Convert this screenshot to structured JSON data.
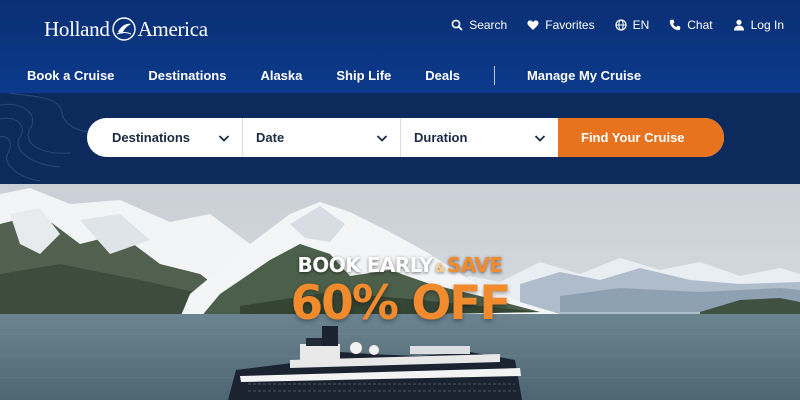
{
  "brand": {
    "name_left": "Holland",
    "name_right": "America"
  },
  "utility_nav": [
    {
      "label": "Search",
      "icon": "search-icon"
    },
    {
      "label": "Favorites",
      "icon": "heart-icon"
    },
    {
      "label": "EN",
      "icon": "globe-icon"
    },
    {
      "label": "Chat",
      "icon": "phone-icon"
    },
    {
      "label": "Log In",
      "icon": "user-icon"
    }
  ],
  "main_nav": {
    "items": [
      "Book a Cruise",
      "Destinations",
      "Alaska",
      "Ship Life",
      "Deals"
    ],
    "manage": "Manage My Cruise"
  },
  "search_bar": {
    "destinations": "Destinations",
    "date": "Date",
    "duration": "Duration",
    "submit": "Find Your Cruise"
  },
  "promo": {
    "line1_a": "BOOK EARLY",
    "amp": "&",
    "line1_b": "SAVE",
    "line2": "60% OFF"
  },
  "colors": {
    "header_blue": "#0a2f74",
    "band_navy": "#0c2b5c",
    "accent_orange": "#e8731f"
  }
}
